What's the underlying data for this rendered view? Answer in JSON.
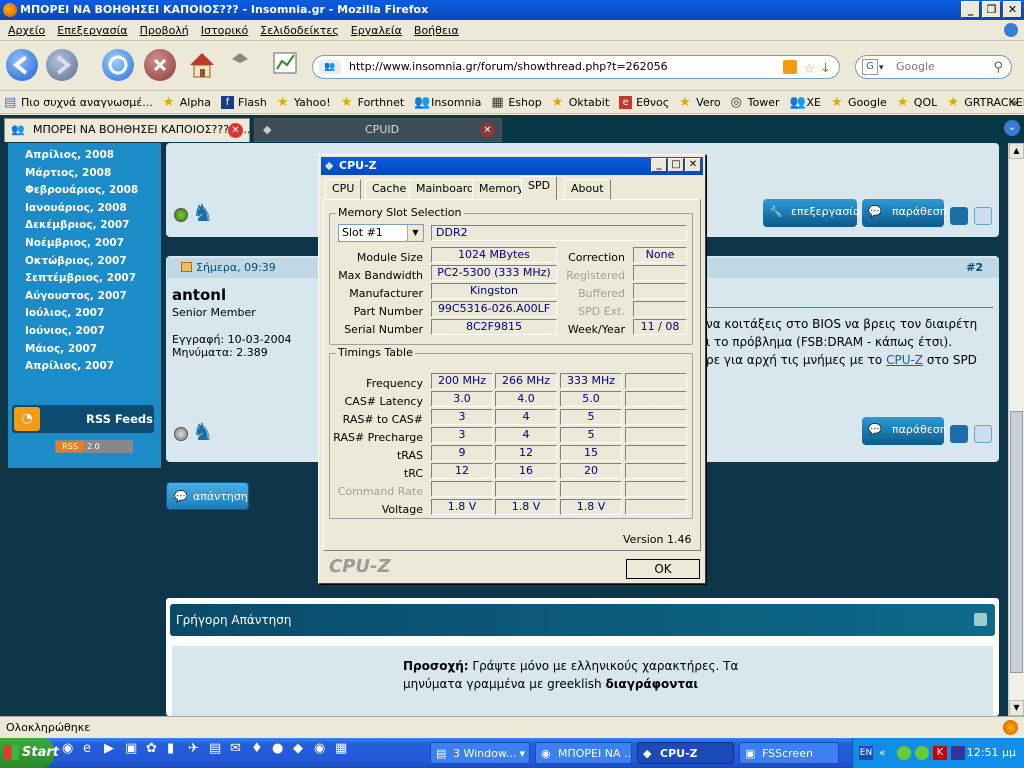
{
  "window": {
    "title": "ΜΠΟΡΕΙ ΝΑ ΒΟΗΘΗΣΕΙ ΚΑΠΟΙΟΣ??? - Insomnia.gr - Mozilla Firefox"
  },
  "menu": [
    "Αρχείο",
    "Επεξεργασία",
    "Προβολή",
    "Ιστορικό",
    "Σελιδοδείκτες",
    "Εργαλεία",
    "Βοήθεια"
  ],
  "url": "http://www.insomnia.gr/forum/showthread.php?t=262056",
  "search_placeholder": "Google",
  "bookmarks": [
    "Πιο συχνά αναγνωσμέ...",
    "Alpha",
    "Flash",
    "Yahoo!",
    "Forthnet",
    "Insomnia",
    "Eshop",
    "Oktabit",
    "Εθνος",
    "Vero",
    "Tower",
    "XE",
    "Google",
    "QOL",
    "GRTRACKER"
  ],
  "tabs": [
    {
      "label": "ΜΠΟΡΕΙ ΝΑ ΒΟΗΘΗΣΕΙ ΚΑΠΟΙΟΣ??? - ..."
    },
    {
      "label": "CPUID"
    }
  ],
  "sidebar": {
    "months": [
      "Απρίλιος, 2008",
      "Μάρτιος, 2008",
      "Φεβρουάριος, 2008",
      "Ιανουάριος, 2008",
      "Δεκέμβριος, 2007",
      "Νοέμβριος, 2007",
      "Οκτώβριος, 2007",
      "Σεπτέμβριος, 2007",
      "Αύγουστος, 2007",
      "Ιούλιος, 2007",
      "Ιούνιος, 2007",
      "Μάιος, 2007",
      "Απρίλιος, 2007"
    ],
    "rss_label": "RSS Feeds",
    "rss_badge_left": "RSS",
    "rss_badge_right": "2.0"
  },
  "post1": {
    "edit_label": "επεξεργασία",
    "quote_label": "παράθεση"
  },
  "post2": {
    "date": "Σήμερα, 09:39",
    "number": "#2",
    "author": "antonl",
    "role": "Senior Member",
    "reg": "Εγγραφή: 10-03-2004",
    "posts": "Μηνύματα: 2.389",
    "line1": "να κοιτάξεις στο BIOS να βρεις τον διαιρέτη",
    "line2": "ι το πρόβλημα (FSB:DRAM - κάπως έτσι).",
    "line3_pre": "ρε για αρχή τις μνήμες με το ",
    "line3_link": "CPU-Z",
    "line3_post": " στο SPD",
    "quote_label": "παράθεση"
  },
  "reply_button": "απάντηση",
  "quick_reply": {
    "title": "Γρήγορη Απάντηση",
    "notice_bold": "Προσοχή:",
    "notice_text": " Γράψτε μόνο με ελληνικούς χαρακτήρες. Τα",
    "notice_line2": "μηνύματα γραμμένα με greeklish ",
    "notice_line2_bold": "διαγράφονται"
  },
  "status": "Ολοκληρώθηκε",
  "cpuz": {
    "title": "CPU-Z",
    "tabs": [
      "CPU",
      "Cache",
      "Mainboard",
      "Memory",
      "SPD",
      "About"
    ],
    "active_tab": "SPD",
    "slot_group": "Memory Slot Selection",
    "slot": "Slot #1",
    "mem_type": "DDR2",
    "labels": {
      "module_size": "Module Size",
      "max_bw": "Max Bandwidth",
      "manufacturer": "Manufacturer",
      "part_number": "Part Number",
      "serial_number": "Serial Number",
      "correction": "Correction",
      "registered": "Registered",
      "buffered": "Buffered",
      "spd_ext": "SPD Ext.",
      "week_year": "Week/Year"
    },
    "values": {
      "module_size": "1024 MBytes",
      "max_bw": "PC2-5300 (333 MHz)",
      "manufacturer": "Kingston",
      "part_number": "99C5316-026.A00LF",
      "serial_number": "8C2F9815",
      "correction": "None",
      "week_year": "11 / 08"
    },
    "timings_group": "Timings Table",
    "timings": [
      {
        "label": "Frequency",
        "values": [
          "200 MHz",
          "266 MHz",
          "333 MHz",
          ""
        ]
      },
      {
        "label": "CAS# Latency",
        "values": [
          "3.0",
          "4.0",
          "5.0",
          ""
        ]
      },
      {
        "label": "RAS# to CAS#",
        "values": [
          "3",
          "4",
          "5",
          ""
        ]
      },
      {
        "label": "RAS# Precharge",
        "values": [
          "3",
          "4",
          "5",
          ""
        ]
      },
      {
        "label": "tRAS",
        "values": [
          "9",
          "12",
          "15",
          ""
        ]
      },
      {
        "label": "tRC",
        "values": [
          "12",
          "16",
          "20",
          ""
        ]
      },
      {
        "label": "Command Rate",
        "values": [
          "",
          "",
          "",
          ""
        ]
      },
      {
        "label": "Voltage",
        "values": [
          "1.8 V",
          "1.8 V",
          "1.8 V",
          ""
        ]
      }
    ],
    "version": "Version 1.46",
    "brand": "CPU-Z",
    "ok": "OK"
  },
  "taskbar": {
    "start": "Start",
    "tasks": [
      "3 Window...",
      "ΜΠΟΡΕΙ ΝΑ ...",
      "CPU-Z",
      "FSScreen"
    ],
    "lang": "EN",
    "clock": "12:51 μμ"
  }
}
